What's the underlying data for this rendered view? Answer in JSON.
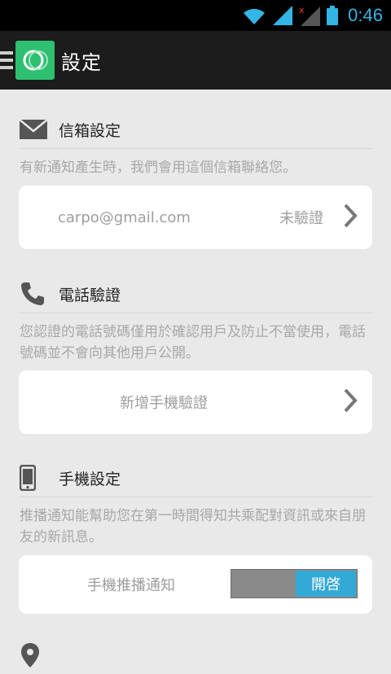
{
  "status_bar": {
    "time": "0:46"
  },
  "action_bar": {
    "title": "設定"
  },
  "sections": {
    "email": {
      "title": "信箱設定",
      "description": "有新通知產生時，我們會用這個信箱聯絡您。",
      "email_value": "carpo@gmail.com",
      "status": "未驗證"
    },
    "phone": {
      "title": "電話驗證",
      "description": "您認證的電話號碼僅用於確認用戶及防止不當使用，電話號碼並不會向其他用戶公開。",
      "add_label": "新增手機驗證"
    },
    "device": {
      "title": "手機設定",
      "description": "推播通知能幫助您在第一時間得知共乘配對資訊或來自朋友的新訊息。",
      "push_label": "手機推播通知",
      "toggle_state": "開啓"
    }
  },
  "colors": {
    "accent": "#33b5e5",
    "logo": "#2fbf71",
    "toggle_on": "#33a9d6"
  }
}
